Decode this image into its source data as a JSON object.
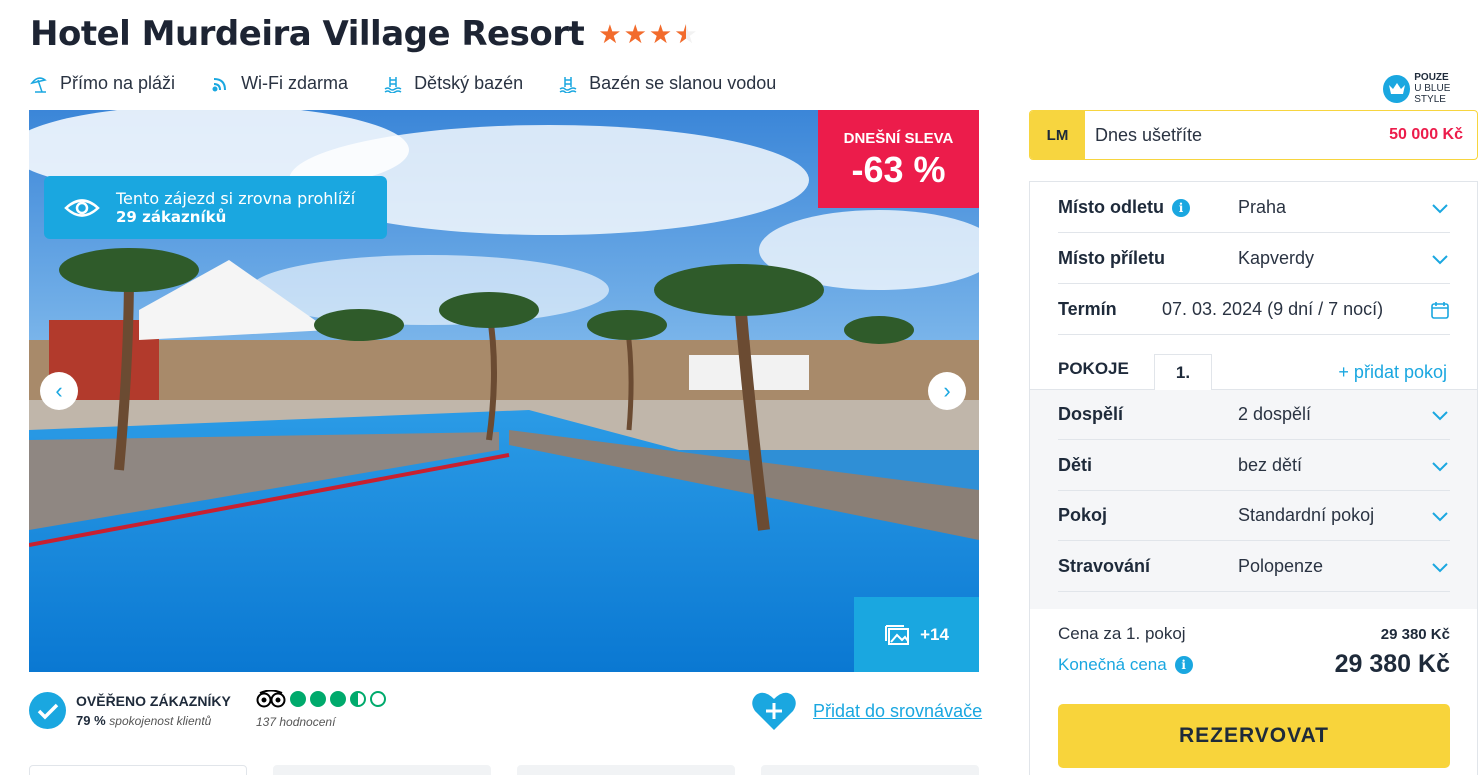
{
  "hotel": {
    "title": "Hotel Murdeira Village Resort",
    "stars": 3.5
  },
  "amenities": [
    {
      "icon": "beach-umbrella-icon",
      "label": "Přímo na pláži"
    },
    {
      "icon": "wifi-icon",
      "label": "Wi-Fi zdarma"
    },
    {
      "icon": "pool-ladder-icon",
      "label": "Dětský bazén"
    },
    {
      "icon": "pool-ladder-icon",
      "label": "Bazén se slanou vodou"
    }
  ],
  "blue_style": {
    "line1": "POUZE",
    "line2": "U BLUE STYLE"
  },
  "gallery": {
    "discount_label": "DNEŠNÍ SLEVA",
    "discount_value": "-63 %",
    "viewers_line1": "Tento zájezd si zrovna prohlíží",
    "viewers_line2": "29 zákazníků",
    "photo_count": "+14"
  },
  "verified": {
    "title": "OVĚŘENO ZÁKAZNÍKY",
    "percent": "79 %",
    "caption": "spokojenost klientů"
  },
  "tripadvisor": {
    "rating": 3.5,
    "count": "137 hodnocení"
  },
  "compare": {
    "link": "Přidat do srovnávače"
  },
  "lm": {
    "badge": "LM",
    "label": "Dnes ušetříte",
    "amount": "50 000 Kč"
  },
  "booking": {
    "departure_label": "Místo odletu",
    "departure_value": "Praha",
    "arrival_label": "Místo příletu",
    "arrival_value": "Kapverdy",
    "term_label": "Termín",
    "term_value": "07. 03. 2024 (9 dní / 7 nocí)",
    "rooms_label": "POKOJE",
    "room_tab": "1.",
    "add_room": "+ přidat pokoj",
    "adults_label": "Dospělí",
    "adults_value": "2 dospělí",
    "children_label": "Děti",
    "children_value": "bez dětí",
    "room_label": "Pokoj",
    "room_value": "Standardní pokoj",
    "board_label": "Stravování",
    "board_value": "Polopenze",
    "price_room_label": "Cena za 1. pokoj",
    "price_room_value": "29 380 Kč",
    "final_label": "Konečná cena",
    "final_value": "29 380 Kč",
    "reserve": "REZERVOVAT"
  },
  "colors": {
    "accent": "#1aa7e0",
    "discount": "#ec1c4b",
    "cta": "#f8d43b",
    "stars": "#f26b2c"
  }
}
